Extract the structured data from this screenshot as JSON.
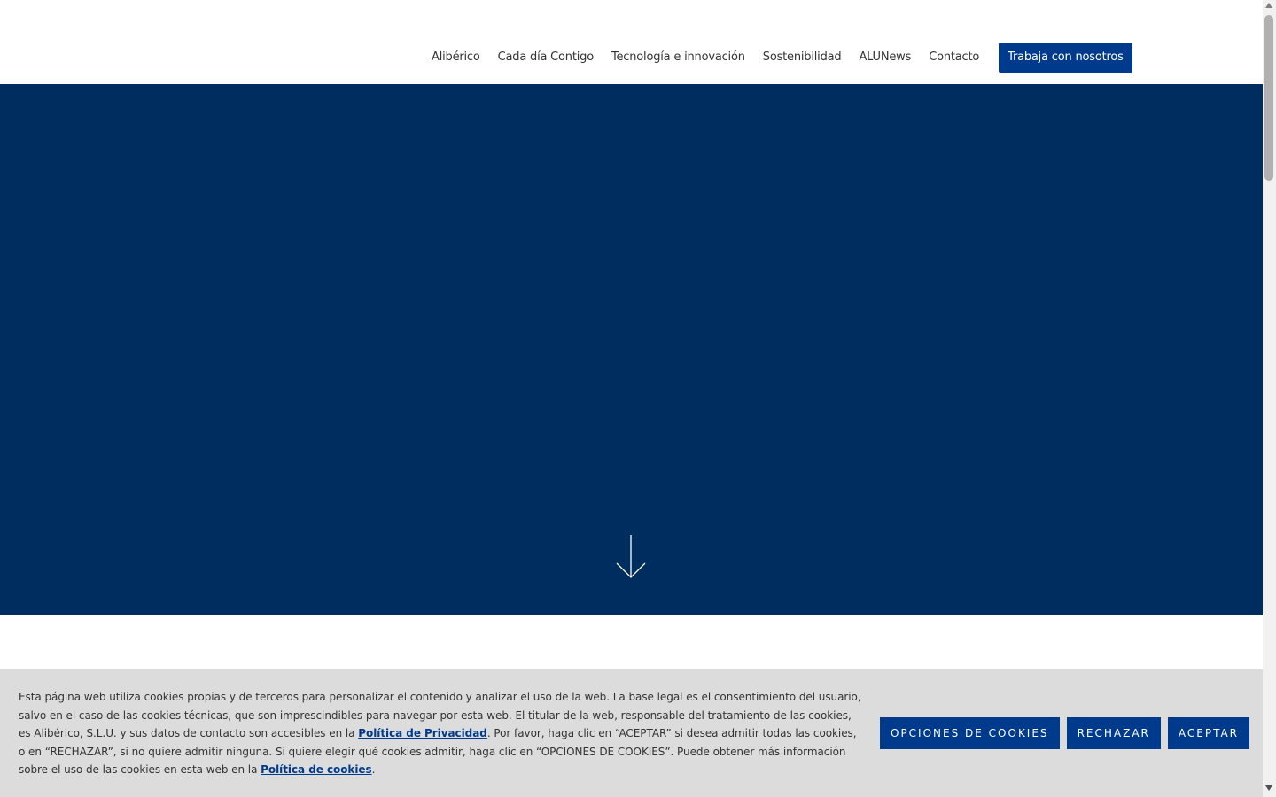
{
  "nav": {
    "items": [
      {
        "label": "Alibérico"
      },
      {
        "label": "Cada día Contigo"
      },
      {
        "label": "Tecnología e innovación"
      },
      {
        "label": "Sostenibilidad"
      },
      {
        "label": "ALUNews"
      },
      {
        "label": "Contacto"
      }
    ],
    "cta_label": "Trabaja con nosotros"
  },
  "hero": {
    "scroll_icon": "arrow-down-icon"
  },
  "cookie_banner": {
    "text_part1": "Esta página web utiliza cookies propias y de terceros para personalizar el contenido y analizar el uso de la web. La base legal es el consentimiento del usuario, salvo en el caso de las cookies técnicas, que son imprescindibles para navegar por esta web. El titular de la web, responsable del tratamiento de las cookies, es Alibérico, S.L.U. y sus datos de contacto son accesibles en la ",
    "privacy_link": "Política de Privacidad",
    "text_part2": ". Por favor, haga clic en “ACEPTAR” si desea admitir todas las cookies, o en “RECHAZAR”, si no quiere admitir ninguna. Si quiere elegir qué cookies admitir, haga clic en “OPCIONES DE COOKIES”. Puede obtener más información sobre el uso de las cookies en esta web en la ",
    "cookies_link": "Política de cookies",
    "text_part3": ".",
    "options_label": "OPCIONES DE COOKIES",
    "reject_label": "RECHAZAR",
    "accept_label": "ACEPTAR"
  },
  "colors": {
    "brand_blue": "#003a8c",
    "hero_bg": "#002d5f",
    "cookie_bg": "#dcdcdc"
  }
}
